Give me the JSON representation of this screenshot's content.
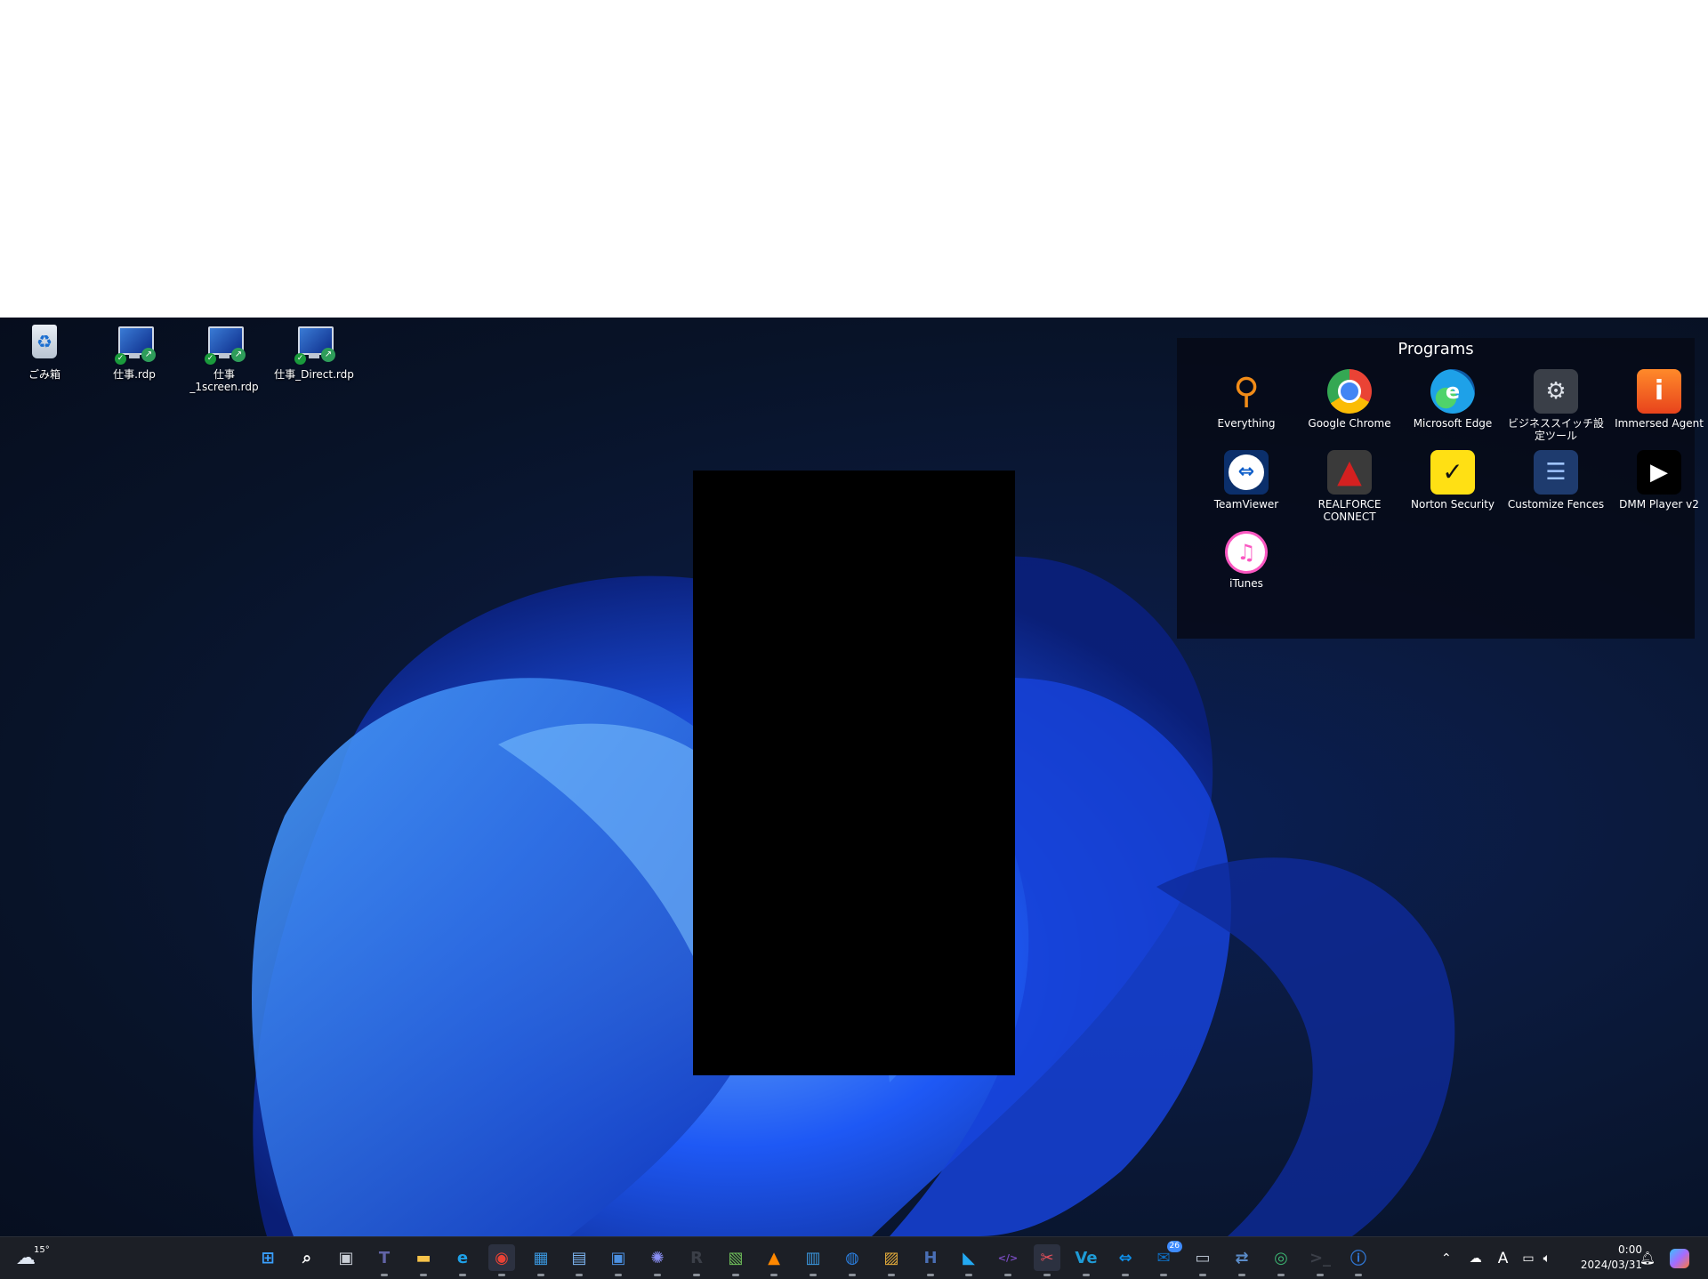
{
  "desktop_icons": [
    {
      "label": "ごみ箱",
      "icon": "recycle-bin-icon"
    },
    {
      "label": "仕事.rdp",
      "icon": "rdp-icon"
    },
    {
      "label": "仕事_1screen.rdp",
      "icon": "rdp-icon"
    },
    {
      "label": "仕事_Direct.rdp",
      "icon": "rdp-icon"
    }
  ],
  "fence": {
    "title": "Programs",
    "items": [
      {
        "label": "Everything",
        "icon": "everything-icon",
        "color": "#f28c18"
      },
      {
        "label": "Google Chrome",
        "icon": "chrome-icon",
        "color": "#4285f4"
      },
      {
        "label": "Microsoft Edge",
        "icon": "edge-icon",
        "color": "#1ea1e8"
      },
      {
        "label": "ビジネススイッチ設定ツール",
        "icon": "switch-settings-icon",
        "color": "#8c93a0"
      },
      {
        "label": "Immersed Agent",
        "icon": "immersed-icon",
        "color": "#ff6a1f"
      },
      {
        "label": "TeamViewer",
        "icon": "teamviewer-icon",
        "color": "#0e8ee9"
      },
      {
        "label": "REALFORCE CONNECT",
        "icon": "realforce-icon",
        "color": "#d42020"
      },
      {
        "label": "Norton Security",
        "icon": "norton-icon",
        "color": "#ffe014"
      },
      {
        "label": "Customize Fences",
        "icon": "fences-icon",
        "color": "#2a6fd6"
      },
      {
        "label": "DMM Player v2",
        "icon": "dmm-player-icon",
        "color": "#000000"
      },
      {
        "label": "iTunes",
        "icon": "itunes-icon",
        "color": "#fa57c1"
      }
    ]
  },
  "taskbar": {
    "weather_temp": "15°",
    "apps": [
      {
        "name": "start-button",
        "glyph": "⊞",
        "color": "#3aa0ff"
      },
      {
        "name": "search-button",
        "glyph": "⌕",
        "color": "#ffffff"
      },
      {
        "name": "task-view-button",
        "glyph": "▣",
        "color": "#c9ced6"
      },
      {
        "name": "teams-icon",
        "glyph": "T",
        "color": "#6264a7"
      },
      {
        "name": "file-explorer-icon",
        "glyph": "▬",
        "color": "#f7c34a"
      },
      {
        "name": "edge-icon",
        "glyph": "e",
        "color": "#1ea1e8"
      },
      {
        "name": "chrome-icon",
        "glyph": "◉",
        "color": "#e94235"
      },
      {
        "name": "store-icon",
        "glyph": "▦",
        "color": "#3a96dd"
      },
      {
        "name": "photos-icon",
        "glyph": "▤",
        "color": "#7db4f0"
      },
      {
        "name": "remote-desktop-icon",
        "glyph": "▣",
        "color": "#4b8fe0"
      },
      {
        "name": "network-icon",
        "glyph": "✺",
        "color": "#8a8ff5"
      },
      {
        "name": "r-app-icon",
        "glyph": "R",
        "color": "#3b3f48"
      },
      {
        "name": "lock-app-icon",
        "glyph": "▧",
        "color": "#6fbf5a"
      },
      {
        "name": "vlc-icon",
        "glyph": "▲",
        "color": "#ff8800"
      },
      {
        "name": "calendar-icon",
        "glyph": "▥",
        "color": "#3a96dd"
      },
      {
        "name": "thunderbird-icon",
        "glyph": "◍",
        "color": "#2b7fe0"
      },
      {
        "name": "archive-app-icon",
        "glyph": "▨",
        "color": "#e0a93a"
      },
      {
        "name": "h-app-icon",
        "glyph": "H",
        "color": "#4a6fb5"
      },
      {
        "name": "vscode-icon",
        "glyph": "◣",
        "color": "#23a9f2"
      },
      {
        "name": "dev-tool-icon",
        "glyph": "</>",
        "color": "#7a4cc2"
      },
      {
        "name": "snipping-icon",
        "glyph": "✂",
        "color": "#e8505b"
      },
      {
        "name": "ve-app-icon",
        "glyph": "Ve",
        "color": "#1f9bd6"
      },
      {
        "name": "teamviewer-icon",
        "glyph": "⇔",
        "color": "#0e8ee9"
      },
      {
        "name": "outlook-icon",
        "glyph": "✉",
        "color": "#0f6cbd",
        "badge": "26"
      },
      {
        "name": "monitor-app-icon",
        "glyph": "▭",
        "color": "#b8c2cf"
      },
      {
        "name": "transfer-app-icon",
        "glyph": "⇄",
        "color": "#5b8cc9"
      },
      {
        "name": "globe-app-icon",
        "glyph": "◎",
        "color": "#3cb371"
      },
      {
        "name": "terminal-icon",
        "glyph": ">_",
        "color": "#3b3f48"
      },
      {
        "name": "password-manager-icon",
        "glyph": "ⓘ",
        "color": "#2f74d0"
      }
    ],
    "tray": {
      "ime": "A",
      "time": "0:00",
      "date": "2024/03/31"
    }
  }
}
